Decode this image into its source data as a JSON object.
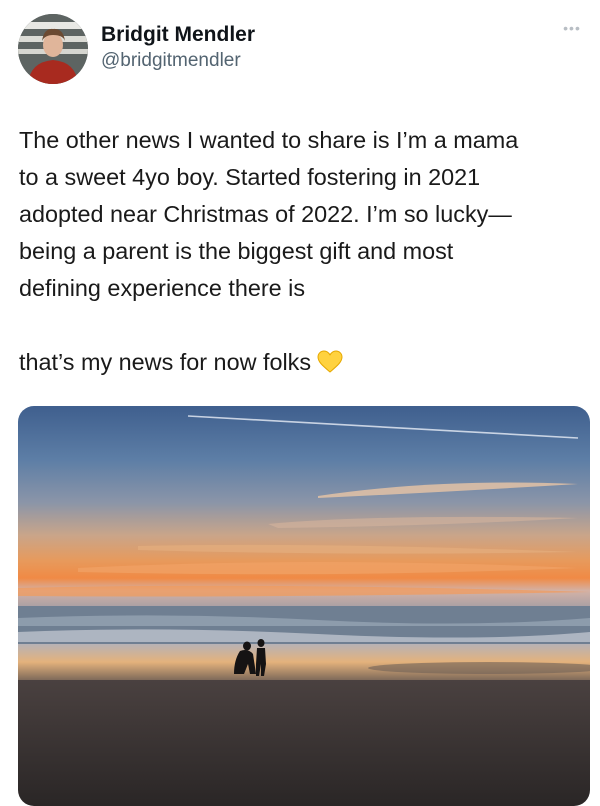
{
  "author": {
    "display_name": "Bridgit Mendler",
    "handle": "@bridgitmendler",
    "avatar_icon": "profile-avatar"
  },
  "more_icon": "ellipsis-icon",
  "tweet": {
    "paragraph_1_lines": [
      "The other news I wanted to share is I’m a mama",
      "to a sweet 4yo boy. Started fostering in 2021",
      "adopted near Christmas of 2022. I’m so lucky—",
      "being a parent is the biggest gift and most",
      "defining experience there is"
    ],
    "paragraph_2": "that’s my news for now folks",
    "emoji": "yellow-heart-icon"
  },
  "media": {
    "type": "photo",
    "subject": "sunset-beach-photo"
  },
  "colors": {
    "text": "#0f1419",
    "handle": "#536471",
    "heart": "#ffd23f"
  }
}
